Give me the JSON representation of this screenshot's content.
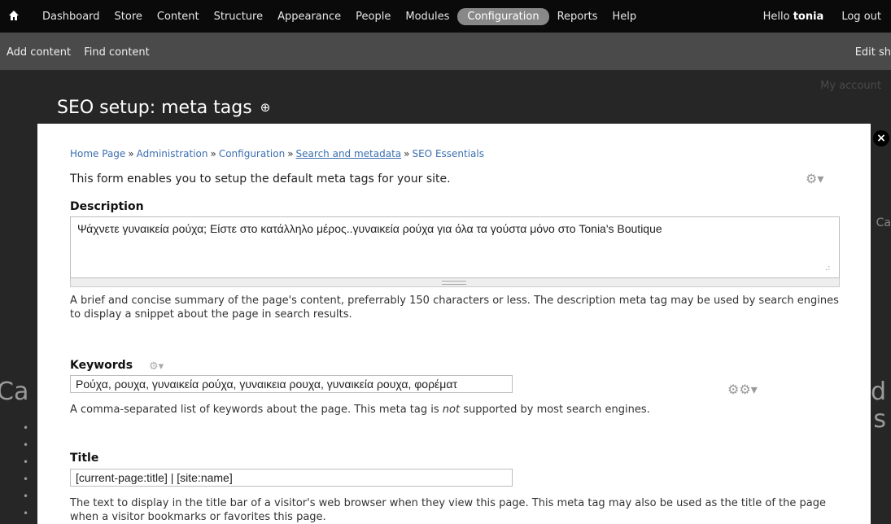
{
  "toolbar": {
    "menu": [
      "Dashboard",
      "Store",
      "Content",
      "Structure",
      "Appearance",
      "People",
      "Modules",
      "Configuration",
      "Reports",
      "Help"
    ],
    "active": "Configuration",
    "hello": "Hello",
    "username": "tonia",
    "logout": "Log out"
  },
  "shortcuts": {
    "add_content": "Add content",
    "find_content": "Find content",
    "edit_shortcuts": "Edit sho"
  },
  "background": {
    "my_account": "My account",
    "ca_left": "Ca",
    "ca_right": "Ca",
    "d_right": "d",
    "s_right": "s"
  },
  "overlay": {
    "title": "SEO setup: meta tags",
    "close": "×"
  },
  "breadcrumb": [
    {
      "text": "Home Page",
      "underline": false
    },
    {
      "text": "Administration",
      "underline": false
    },
    {
      "text": "Configuration",
      "underline": false
    },
    {
      "text": "Search and metadata",
      "underline": true
    },
    {
      "text": "SEO Essentials",
      "underline": false
    }
  ],
  "intro": "This form enables you to setup the default meta tags for your site.",
  "description": {
    "label": "Description",
    "value": "Ψάχνετε γυναικεία ρούχα; Είστε στο κατάλληλο μέρος..γυναικεία ρούχα για όλα τα γούστα μόνο στο Tonia's Boutique",
    "help": "A brief and concise summary of the page's content, preferrably 150 characters or less. The description meta tag may be used by search engines to display a snippet about the page in search results."
  },
  "keywords": {
    "label": "Keywords",
    "value": "Ρούχα, ρουχα, γυναικεία ρούχα, γυναικεια ρουχα, γυναικεία ρουχα, φορέματ",
    "help_before": "A comma-separated list of keywords about the page. This meta tag is ",
    "help_em": "not",
    "help_after": " supported by most search engines."
  },
  "title": {
    "label": "Title",
    "value": "[current-page:title] | [site:name]",
    "help": "The text to display in the title bar of a visitor's web browser when they view this page. This meta tag may also be used as the title of the page when a visitor bookmarks or favorites this page."
  },
  "icons": [
    "home-icon",
    "plus-circle-icon",
    "close-icon",
    "gear-icon",
    "resize-grip-icon"
  ],
  "colors": {
    "toolbar": "#0a0a0a",
    "active_tab": "#888888",
    "link": "#3b6fb0",
    "overlay_bg": "#262626"
  }
}
